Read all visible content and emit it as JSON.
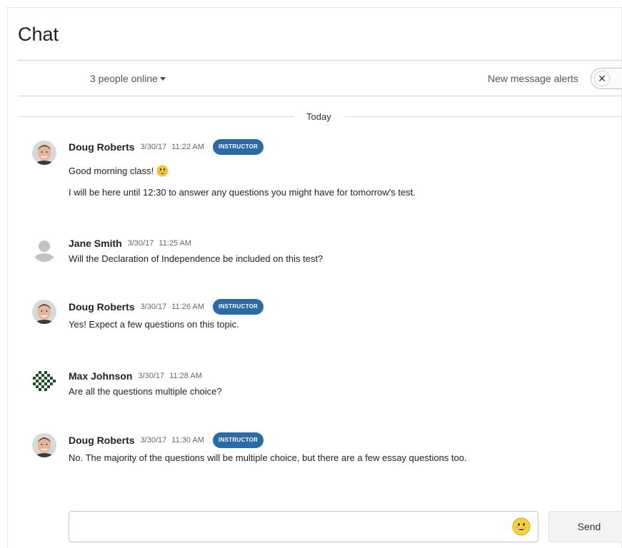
{
  "chat": {
    "title": "Chat",
    "online_label": "3 people online",
    "alerts_label": "New message alerts",
    "toggle_symbol": "✕",
    "divider_label": "Today"
  },
  "messages": [
    {
      "name": "Doug Roberts",
      "date": "3/30/17",
      "time": "11:22 AM",
      "badge": "INSTRUCTOR",
      "avatar": "photo-avatar",
      "lines": [
        "Good morning class!",
        "I will be here until 12:30 to answer any questions you might have for tomorrow's test."
      ],
      "has_emoji": true
    },
    {
      "name": "Jane Smith",
      "date": "3/30/17",
      "time": "11:25 AM",
      "badge": "",
      "avatar": "default-avatar",
      "lines": [
        "Will the Declaration of Independence be included on this test?"
      ]
    },
    {
      "name": "Doug Roberts",
      "date": "3/30/17",
      "time": "11:26 AM",
      "badge": "INSTRUCTOR",
      "avatar": "photo-avatar",
      "lines": [
        "Yes! Expect a few questions on this topic."
      ]
    },
    {
      "name": "Max Johnson",
      "date": "3/30/17",
      "time": "11:28 AM",
      "badge": "",
      "avatar": "pattern-avatar",
      "lines": [
        "Are all the questions multiple choice?"
      ]
    },
    {
      "name": "Doug Roberts",
      "date": "3/30/17",
      "time": "11:30 AM",
      "badge": "INSTRUCTOR",
      "avatar": "photo-avatar",
      "lines": [
        "No. The majority of the questions will be multiple choice, but there are a few essay questions too."
      ]
    }
  ],
  "composer": {
    "value": "",
    "placeholder": "",
    "emoji_icon": "smiley-icon",
    "send_label": "Send"
  },
  "colors": {
    "badge": "#2a6aa7",
    "divider": "#d0d0d0"
  }
}
